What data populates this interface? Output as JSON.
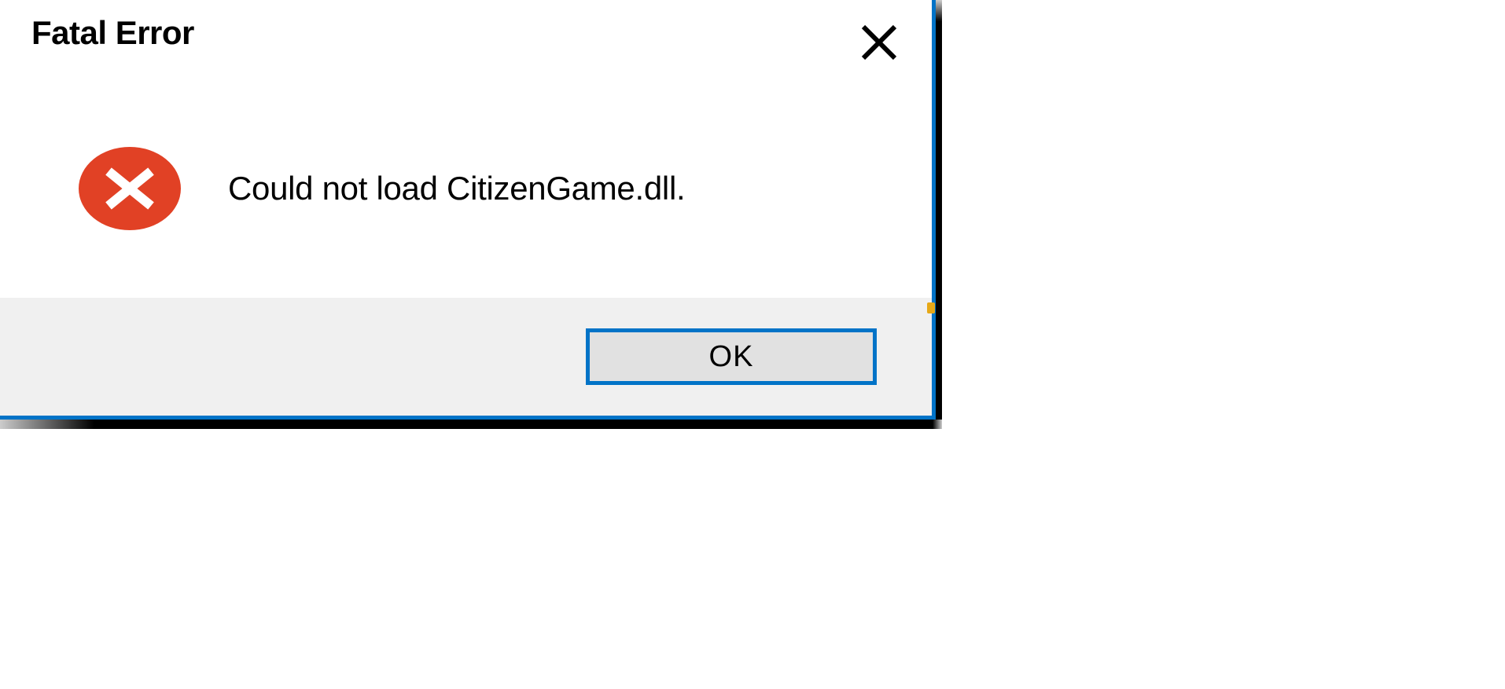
{
  "dialog": {
    "title": "Fatal Error",
    "message": "Could not load CitizenGame.dll.",
    "ok_label": "OK"
  },
  "icons": {
    "close": "close-icon",
    "error": "error-icon"
  },
  "colors": {
    "accent": "#0173c7",
    "error_bg": "#e14125",
    "button_bar_bg": "#f0f0f0",
    "button_bg": "#e1e1e1"
  }
}
